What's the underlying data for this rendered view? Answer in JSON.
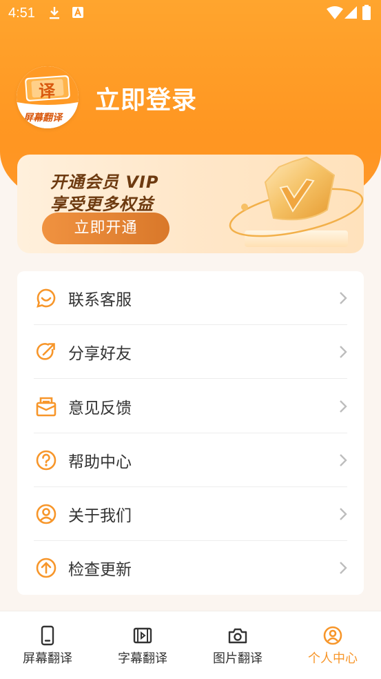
{
  "status_bar": {
    "time": "4:51"
  },
  "profile": {
    "logo_text_top": "译",
    "logo_text_bottom": "屏幕翻译",
    "login_label": "立即登录"
  },
  "vip_banner": {
    "line1": "开通会员 VIP",
    "line2": "享受更多权益",
    "button_label": "立即开通"
  },
  "menu": {
    "items": [
      {
        "label": "联系客服",
        "icon": "customer-service-icon"
      },
      {
        "label": "分享好友",
        "icon": "share-icon"
      },
      {
        "label": "意见反馈",
        "icon": "feedback-icon"
      },
      {
        "label": "帮助中心",
        "icon": "help-icon"
      },
      {
        "label": "关于我们",
        "icon": "about-icon"
      },
      {
        "label": "检查更新",
        "icon": "update-icon"
      }
    ]
  },
  "bottom_nav": {
    "items": [
      {
        "label": "屏幕翻译",
        "icon": "phone-icon",
        "active": false
      },
      {
        "label": "字幕翻译",
        "icon": "video-icon",
        "active": false
      },
      {
        "label": "图片翻译",
        "icon": "camera-icon",
        "active": false
      },
      {
        "label": "个人中心",
        "icon": "user-icon",
        "active": true
      }
    ]
  },
  "colors": {
    "accent": "#ff9722",
    "active_nav": "#f7962a",
    "vip_text": "#6d3a10"
  }
}
